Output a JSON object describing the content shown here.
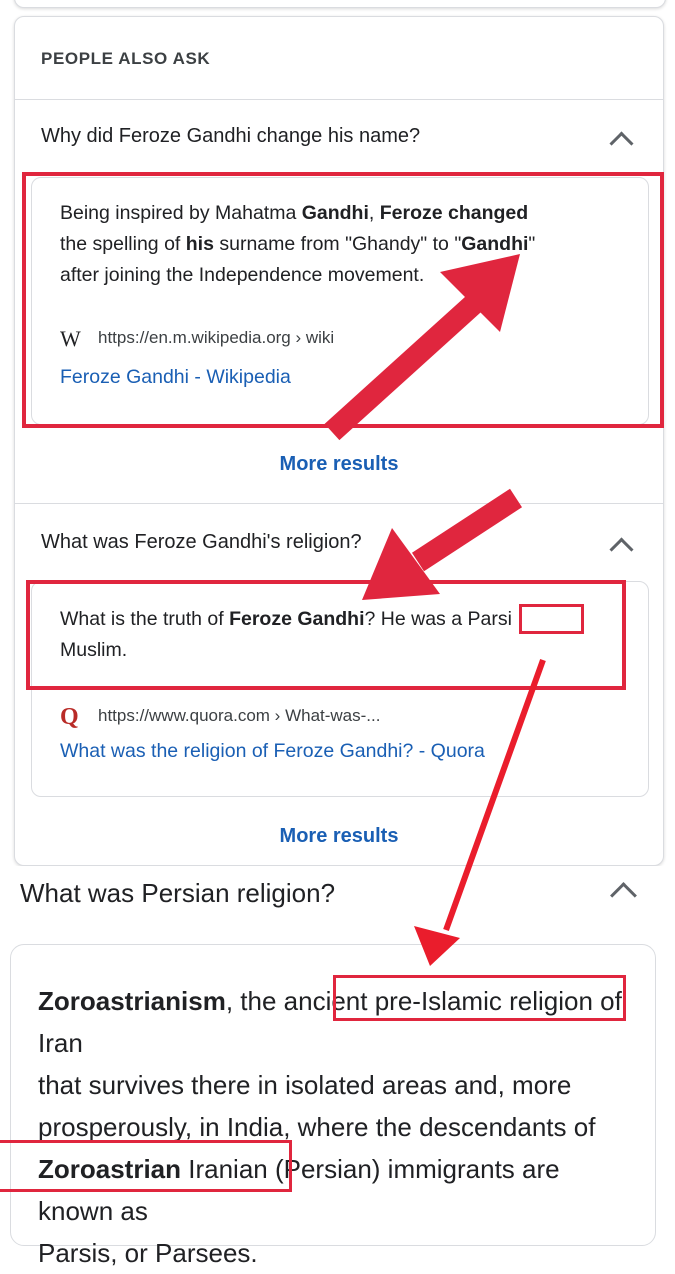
{
  "paa": {
    "heading": "PEOPLE ALSO ASK",
    "q1": {
      "question": "Why did Feroze Gandhi change his name?",
      "snippet": {
        "t1": "Being inspired by Mahatma ",
        "b1": "Gandhi",
        "t2": ", ",
        "b2": "Feroze changed",
        "t3": "the spelling of ",
        "b3": "his",
        "t4": " surname from \"Ghandy\" to \"",
        "b4": "Gandhi",
        "t5": "\"",
        "t6": "after joining the Independence movement."
      },
      "source_icon": "W",
      "source_url": "https://en.m.wikipedia.org › wiki",
      "link": "Feroze Gandhi - Wikipedia",
      "more": "More results"
    },
    "q2": {
      "question": "What was Feroze Gandhi's religion?",
      "snippet": {
        "t1": "What is the truth of ",
        "b1": "Feroze Gandhi",
        "t2": "? He was a ",
        "t3": "Parsi",
        "t4": "Muslim."
      },
      "source_icon": "Q",
      "source_url": "https://www.quora.com › What-was-...",
      "link": "What was the religion of Feroze Gandhi? - Quora",
      "more": "More results"
    }
  },
  "q3": {
    "question": "What was Persian religion?",
    "snippet": {
      "b1": "Zoroastrianism",
      "t1": ", the ancient ",
      "t2": "pre-Islamic religion of Iran",
      "t3": "that survives there in isolated areas and, more",
      "t4": "prosperously, in India, where the descendants of",
      "b2": "Zoroastrian",
      "t5": " Iranian (Persian) immigrants are known as",
      "t6": "Parsis, or Parsees."
    }
  },
  "colors": {
    "annotation_red": "#e0263e",
    "link_blue": "#1a5fb4"
  },
  "icons": [
    "chevron-up-icon",
    "wikipedia-icon",
    "quora-icon",
    "red-arrow"
  ]
}
